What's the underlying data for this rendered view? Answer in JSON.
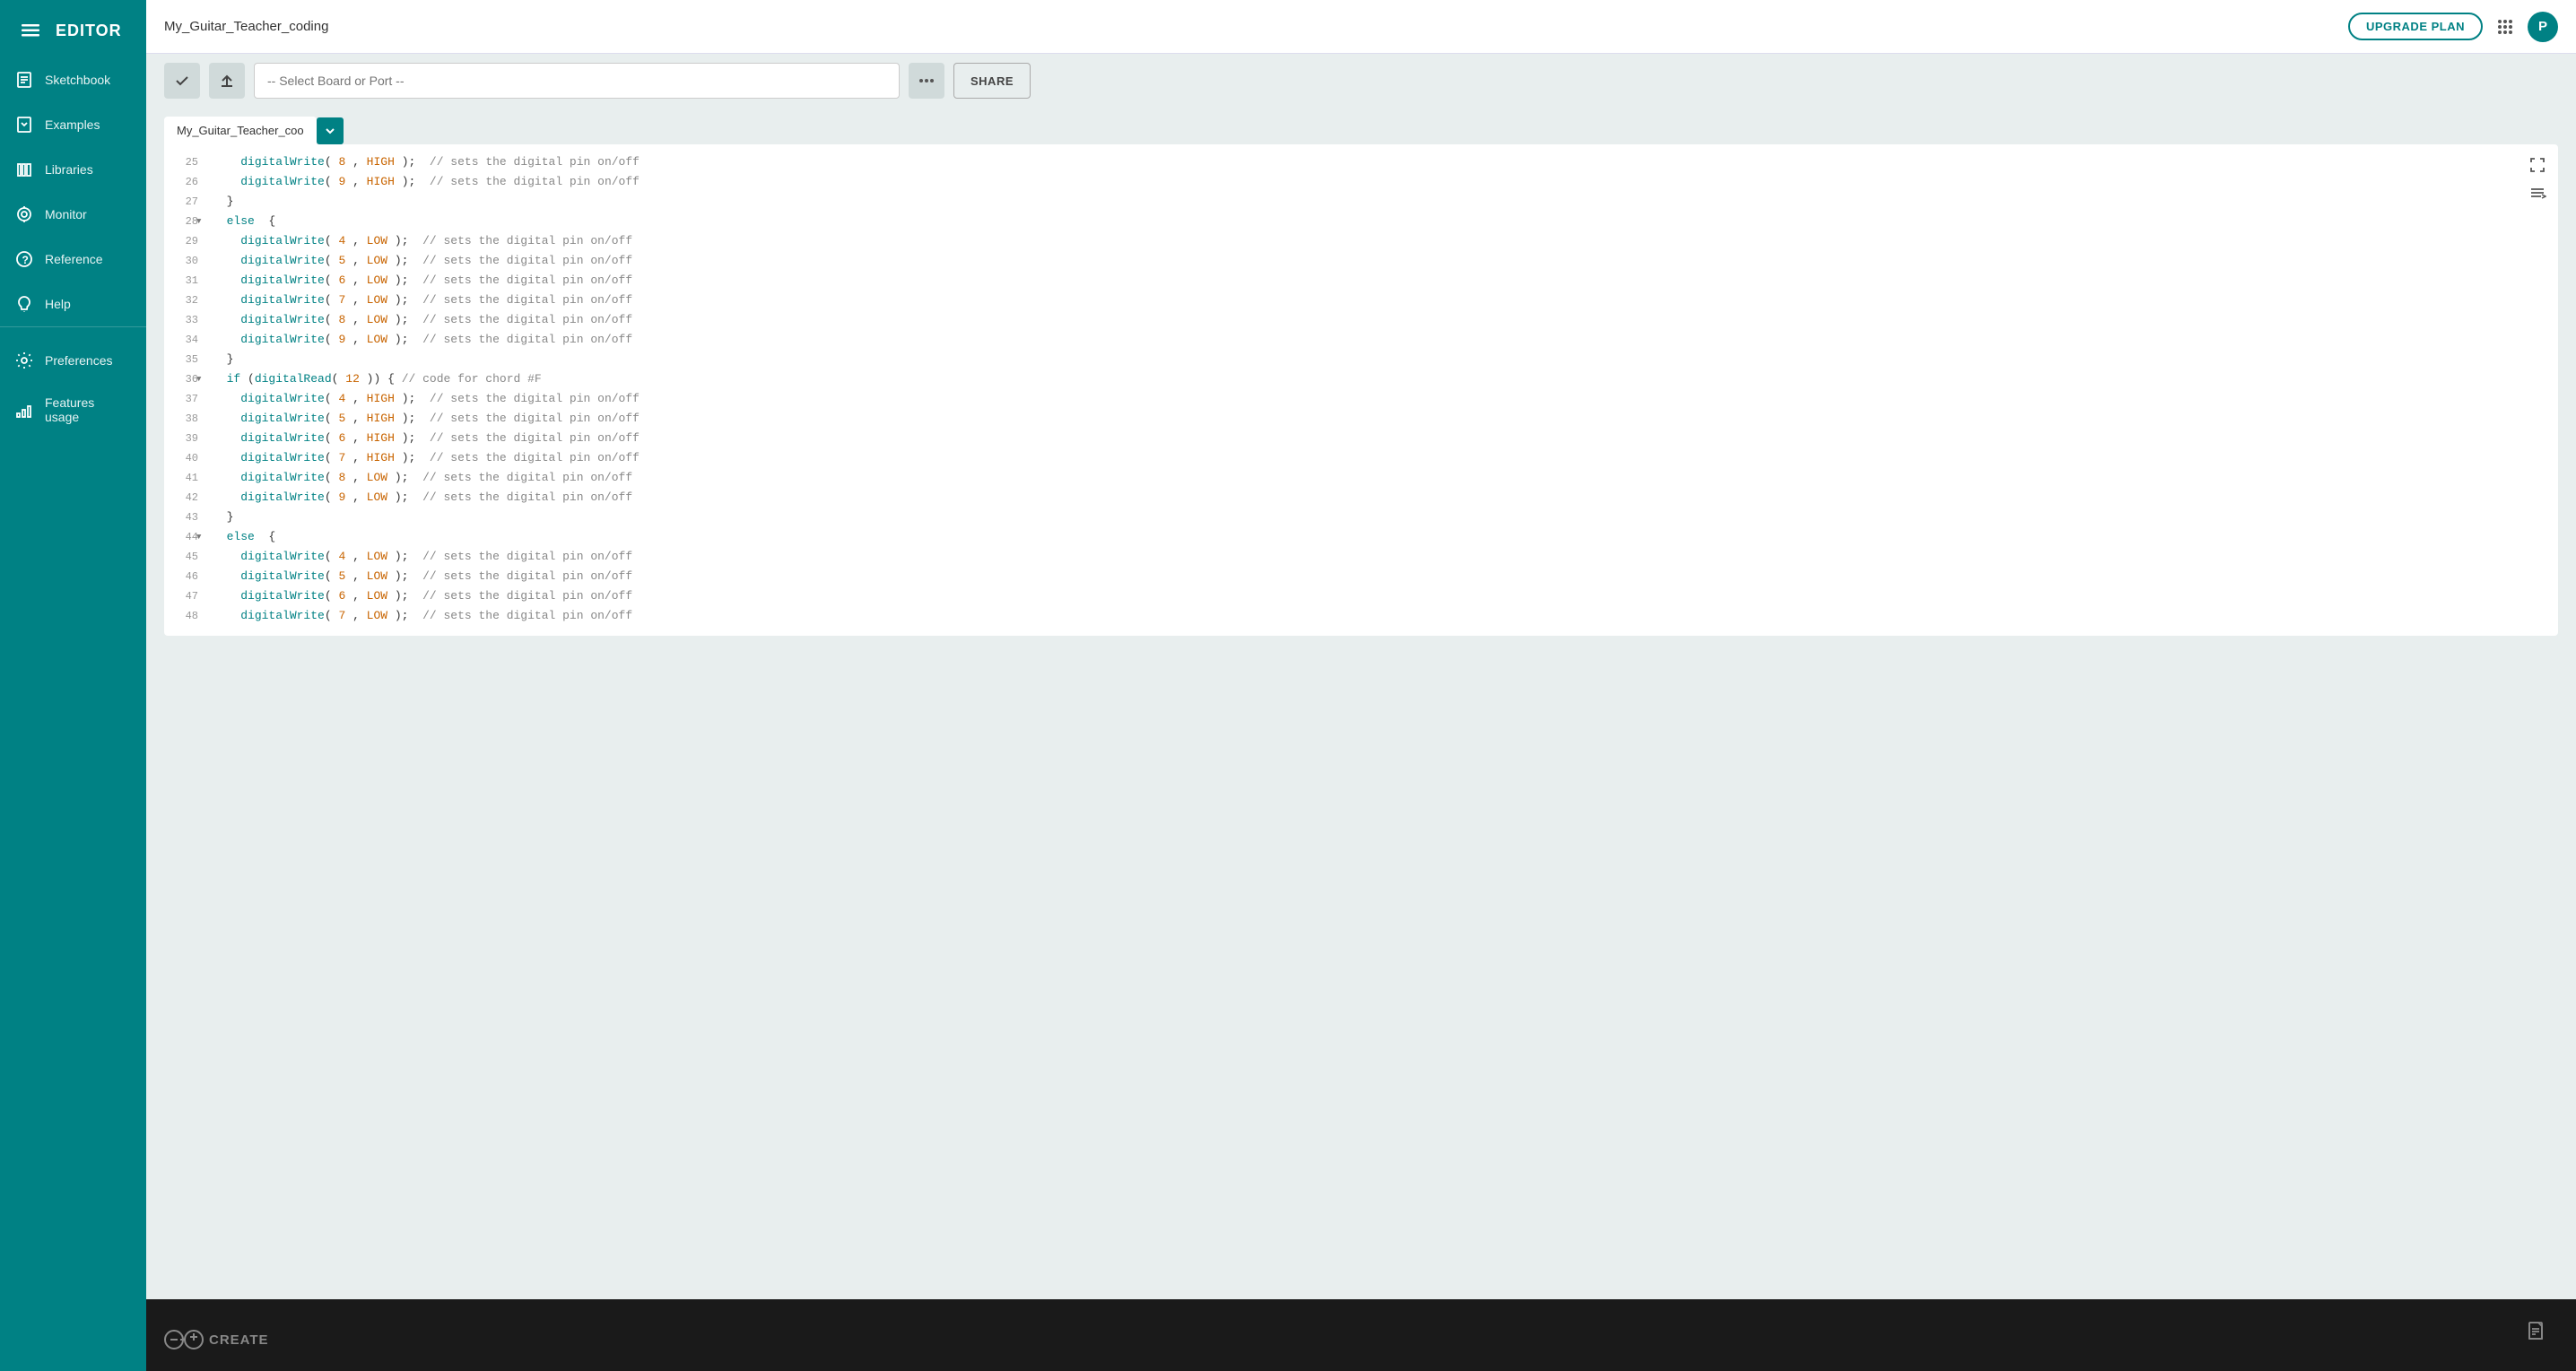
{
  "sidebar": {
    "logo_text": "EDITOR",
    "items": [
      {
        "id": "sketchbook",
        "label": "Sketchbook",
        "icon": "📁"
      },
      {
        "id": "examples",
        "label": "Examples",
        "icon": "📋"
      },
      {
        "id": "libraries",
        "label": "Libraries",
        "icon": "📚"
      },
      {
        "id": "monitor",
        "label": "Monitor",
        "icon": "🔍"
      },
      {
        "id": "reference",
        "label": "Reference",
        "icon": "❓"
      },
      {
        "id": "help",
        "label": "Help",
        "icon": "💬"
      },
      {
        "id": "preferences",
        "label": "Preferences",
        "icon": "⚙"
      },
      {
        "id": "features",
        "label": "Features usage",
        "icon": "📊"
      }
    ]
  },
  "topbar": {
    "title": "My_Guitar_Teacher_coding",
    "upgrade_label": "UPGRADE PLAN",
    "avatar_letter": "P"
  },
  "toolbar": {
    "verify_title": "Verify",
    "upload_title": "Upload",
    "board_placeholder": "-- Select Board or Port --",
    "more_title": "More options",
    "share_label": "SHARE"
  },
  "tab": {
    "label": "My_Guitar_Teacher_coo",
    "dropdown_title": "Tab dropdown"
  },
  "code": {
    "lines": [
      {
        "num": "25",
        "fold": false,
        "content": "    digitalWrite( 8 , HIGH );  // sets the digital pin on/off",
        "tokens": [
          {
            "text": "    ",
            "cls": ""
          },
          {
            "text": "digitalWrite",
            "cls": "kw-teal"
          },
          {
            "text": "( ",
            "cls": ""
          },
          {
            "text": "8",
            "cls": "kw-orange"
          },
          {
            "text": " , ",
            "cls": ""
          },
          {
            "text": "HIGH",
            "cls": "kw-orange"
          },
          {
            "text": " );  ",
            "cls": ""
          },
          {
            "text": "// sets the digital pin on/off",
            "cls": "kw-comment"
          }
        ]
      },
      {
        "num": "26",
        "fold": false,
        "content": "    digitalWrite( 9 , HIGH );  // sets the digital pin on/off",
        "tokens": [
          {
            "text": "    ",
            "cls": ""
          },
          {
            "text": "digitalWrite",
            "cls": "kw-teal"
          },
          {
            "text": "( ",
            "cls": ""
          },
          {
            "text": "9",
            "cls": "kw-orange"
          },
          {
            "text": " , ",
            "cls": ""
          },
          {
            "text": "HIGH",
            "cls": "kw-orange"
          },
          {
            "text": " );  ",
            "cls": ""
          },
          {
            "text": "// sets the digital pin on/off",
            "cls": "kw-comment"
          }
        ]
      },
      {
        "num": "27",
        "fold": false,
        "content": "  }",
        "tokens": [
          {
            "text": "  }",
            "cls": ""
          }
        ]
      },
      {
        "num": "28",
        "fold": true,
        "content": "  else  {",
        "tokens": [
          {
            "text": "  ",
            "cls": ""
          },
          {
            "text": "else",
            "cls": "kw-teal"
          },
          {
            "text": "  {",
            "cls": ""
          }
        ]
      },
      {
        "num": "29",
        "fold": false,
        "content": "    digitalWrite( 4 , LOW );  // sets the digital pin on/off",
        "tokens": [
          {
            "text": "    ",
            "cls": ""
          },
          {
            "text": "digitalWrite",
            "cls": "kw-teal"
          },
          {
            "text": "( ",
            "cls": ""
          },
          {
            "text": "4",
            "cls": "kw-orange"
          },
          {
            "text": " , ",
            "cls": ""
          },
          {
            "text": "LOW",
            "cls": "kw-orange"
          },
          {
            "text": " );  ",
            "cls": ""
          },
          {
            "text": "// sets the digital pin on/off",
            "cls": "kw-comment"
          }
        ]
      },
      {
        "num": "30",
        "fold": false,
        "content": "    digitalWrite( 5 , LOW );  // sets the digital pin on/off",
        "tokens": [
          {
            "text": "    ",
            "cls": ""
          },
          {
            "text": "digitalWrite",
            "cls": "kw-teal"
          },
          {
            "text": "( ",
            "cls": ""
          },
          {
            "text": "5",
            "cls": "kw-orange"
          },
          {
            "text": " , ",
            "cls": ""
          },
          {
            "text": "LOW",
            "cls": "kw-orange"
          },
          {
            "text": " );  ",
            "cls": ""
          },
          {
            "text": "// sets the digital pin on/off",
            "cls": "kw-comment"
          }
        ]
      },
      {
        "num": "31",
        "fold": false,
        "content": "    digitalWrite( 6 , LOW );  // sets the digital pin on/off",
        "tokens": [
          {
            "text": "    ",
            "cls": ""
          },
          {
            "text": "digitalWrite",
            "cls": "kw-teal"
          },
          {
            "text": "( ",
            "cls": ""
          },
          {
            "text": "6",
            "cls": "kw-orange"
          },
          {
            "text": " , ",
            "cls": ""
          },
          {
            "text": "LOW",
            "cls": "kw-orange"
          },
          {
            "text": " );  ",
            "cls": ""
          },
          {
            "text": "// sets the digital pin on/off",
            "cls": "kw-comment"
          }
        ]
      },
      {
        "num": "32",
        "fold": false,
        "content": "    digitalWrite( 7 , LOW );  // sets the digital pin on/off",
        "tokens": [
          {
            "text": "    ",
            "cls": ""
          },
          {
            "text": "digitalWrite",
            "cls": "kw-teal"
          },
          {
            "text": "( ",
            "cls": ""
          },
          {
            "text": "7",
            "cls": "kw-orange"
          },
          {
            "text": " , ",
            "cls": ""
          },
          {
            "text": "LOW",
            "cls": "kw-orange"
          },
          {
            "text": " );  ",
            "cls": ""
          },
          {
            "text": "// sets the digital pin on/off",
            "cls": "kw-comment"
          }
        ]
      },
      {
        "num": "33",
        "fold": false,
        "content": "    digitalWrite( 8 , LOW );  // sets the digital pin on/off",
        "tokens": [
          {
            "text": "    ",
            "cls": ""
          },
          {
            "text": "digitalWrite",
            "cls": "kw-teal"
          },
          {
            "text": "( ",
            "cls": ""
          },
          {
            "text": "8",
            "cls": "kw-orange"
          },
          {
            "text": " , ",
            "cls": ""
          },
          {
            "text": "LOW",
            "cls": "kw-orange"
          },
          {
            "text": " );  ",
            "cls": ""
          },
          {
            "text": "// sets the digital pin on/off",
            "cls": "kw-comment"
          }
        ]
      },
      {
        "num": "34",
        "fold": false,
        "content": "    digitalWrite( 9 , LOW );  // sets the digital pin on/off",
        "tokens": [
          {
            "text": "    ",
            "cls": ""
          },
          {
            "text": "digitalWrite",
            "cls": "kw-teal"
          },
          {
            "text": "( ",
            "cls": ""
          },
          {
            "text": "9",
            "cls": "kw-orange"
          },
          {
            "text": " , ",
            "cls": ""
          },
          {
            "text": "LOW",
            "cls": "kw-orange"
          },
          {
            "text": " );  ",
            "cls": ""
          },
          {
            "text": "// sets the digital pin on/off",
            "cls": "kw-comment"
          }
        ]
      },
      {
        "num": "35",
        "fold": false,
        "content": "  }",
        "tokens": [
          {
            "text": "  }",
            "cls": ""
          }
        ]
      },
      {
        "num": "36",
        "fold": true,
        "content": "  if (digitalRead( 12 )) { // code for chord #F",
        "tokens": [
          {
            "text": "  ",
            "cls": ""
          },
          {
            "text": "if",
            "cls": "kw-teal"
          },
          {
            "text": " (",
            "cls": ""
          },
          {
            "text": "digitalRead",
            "cls": "kw-teal"
          },
          {
            "text": "( ",
            "cls": ""
          },
          {
            "text": "12",
            "cls": "kw-orange"
          },
          {
            "text": " )) { ",
            "cls": ""
          },
          {
            "text": "// code for chord #F",
            "cls": "kw-comment"
          }
        ]
      },
      {
        "num": "37",
        "fold": false,
        "content": "    digitalWrite( 4 , HIGH );  // sets the digital pin on/off",
        "tokens": [
          {
            "text": "    ",
            "cls": ""
          },
          {
            "text": "digitalWrite",
            "cls": "kw-teal"
          },
          {
            "text": "( ",
            "cls": ""
          },
          {
            "text": "4",
            "cls": "kw-orange"
          },
          {
            "text": " , ",
            "cls": ""
          },
          {
            "text": "HIGH",
            "cls": "kw-orange"
          },
          {
            "text": " );  ",
            "cls": ""
          },
          {
            "text": "// sets the digital pin on/off",
            "cls": "kw-comment"
          }
        ]
      },
      {
        "num": "38",
        "fold": false,
        "content": "    digitalWrite( 5 , HIGH );  // sets the digital pin on/off",
        "tokens": [
          {
            "text": "    ",
            "cls": ""
          },
          {
            "text": "digitalWrite",
            "cls": "kw-teal"
          },
          {
            "text": "( ",
            "cls": ""
          },
          {
            "text": "5",
            "cls": "kw-orange"
          },
          {
            "text": " , ",
            "cls": ""
          },
          {
            "text": "HIGH",
            "cls": "kw-orange"
          },
          {
            "text": " );  ",
            "cls": ""
          },
          {
            "text": "// sets the digital pin on/off",
            "cls": "kw-comment"
          }
        ]
      },
      {
        "num": "39",
        "fold": false,
        "content": "    digitalWrite( 6 , HIGH );  // sets the digital pin on/off",
        "tokens": [
          {
            "text": "    ",
            "cls": ""
          },
          {
            "text": "digitalWrite",
            "cls": "kw-teal"
          },
          {
            "text": "( ",
            "cls": ""
          },
          {
            "text": "6",
            "cls": "kw-orange"
          },
          {
            "text": " , ",
            "cls": ""
          },
          {
            "text": "HIGH",
            "cls": "kw-orange"
          },
          {
            "text": " );  ",
            "cls": ""
          },
          {
            "text": "// sets the digital pin on/off",
            "cls": "kw-comment"
          }
        ]
      },
      {
        "num": "40",
        "fold": false,
        "content": "    digitalWrite( 7 , HIGH );  // sets the digital pin on/off",
        "tokens": [
          {
            "text": "    ",
            "cls": ""
          },
          {
            "text": "digitalWrite",
            "cls": "kw-teal"
          },
          {
            "text": "( ",
            "cls": ""
          },
          {
            "text": "7",
            "cls": "kw-orange"
          },
          {
            "text": " , ",
            "cls": ""
          },
          {
            "text": "HIGH",
            "cls": "kw-orange"
          },
          {
            "text": " );  ",
            "cls": ""
          },
          {
            "text": "// sets the digital pin on/off",
            "cls": "kw-comment"
          }
        ]
      },
      {
        "num": "41",
        "fold": false,
        "content": "    digitalWrite( 8 , LOW );  // sets the digital pin on/off",
        "tokens": [
          {
            "text": "    ",
            "cls": ""
          },
          {
            "text": "digitalWrite",
            "cls": "kw-teal"
          },
          {
            "text": "( ",
            "cls": ""
          },
          {
            "text": "8",
            "cls": "kw-orange"
          },
          {
            "text": " , ",
            "cls": ""
          },
          {
            "text": "LOW",
            "cls": "kw-orange"
          },
          {
            "text": " );  ",
            "cls": ""
          },
          {
            "text": "// sets the digital pin on/off",
            "cls": "kw-comment"
          }
        ]
      },
      {
        "num": "42",
        "fold": false,
        "content": "    digitalWrite( 9 , LOW );  // sets the digital pin on/off",
        "tokens": [
          {
            "text": "    ",
            "cls": ""
          },
          {
            "text": "digitalWrite",
            "cls": "kw-teal"
          },
          {
            "text": "( ",
            "cls": ""
          },
          {
            "text": "9",
            "cls": "kw-orange"
          },
          {
            "text": " , ",
            "cls": ""
          },
          {
            "text": "LOW",
            "cls": "kw-orange"
          },
          {
            "text": " );  ",
            "cls": ""
          },
          {
            "text": "// sets the digital pin on/off",
            "cls": "kw-comment"
          }
        ]
      },
      {
        "num": "43",
        "fold": false,
        "content": "  }",
        "tokens": [
          {
            "text": "  }",
            "cls": ""
          }
        ]
      },
      {
        "num": "44",
        "fold": true,
        "content": "  else  {",
        "tokens": [
          {
            "text": "  ",
            "cls": ""
          },
          {
            "text": "else",
            "cls": "kw-teal"
          },
          {
            "text": "  {",
            "cls": ""
          }
        ]
      },
      {
        "num": "45",
        "fold": false,
        "content": "    digitalWrite( 4 , LOW );  // sets the digital pin on/off",
        "tokens": [
          {
            "text": "    ",
            "cls": ""
          },
          {
            "text": "digitalWrite",
            "cls": "kw-teal"
          },
          {
            "text": "( ",
            "cls": ""
          },
          {
            "text": "4",
            "cls": "kw-orange"
          },
          {
            "text": " , ",
            "cls": ""
          },
          {
            "text": "LOW",
            "cls": "kw-orange"
          },
          {
            "text": " );  ",
            "cls": ""
          },
          {
            "text": "// sets the digital pin on/off",
            "cls": "kw-comment"
          }
        ]
      },
      {
        "num": "46",
        "fold": false,
        "content": "    digitalWrite( 5 , LOW );  // sets the digital pin on/off",
        "tokens": [
          {
            "text": "    ",
            "cls": ""
          },
          {
            "text": "digitalWrite",
            "cls": "kw-teal"
          },
          {
            "text": "( ",
            "cls": ""
          },
          {
            "text": "5",
            "cls": "kw-orange"
          },
          {
            "text": " , ",
            "cls": ""
          },
          {
            "text": "LOW",
            "cls": "kw-orange"
          },
          {
            "text": " );  ",
            "cls": ""
          },
          {
            "text": "// sets the digital pin on/off",
            "cls": "kw-comment"
          }
        ]
      },
      {
        "num": "47",
        "fold": false,
        "content": "    digitalWrite( 6 , LOW );  // sets the digital pin on/off",
        "tokens": [
          {
            "text": "    ",
            "cls": ""
          },
          {
            "text": "digitalWrite",
            "cls": "kw-teal"
          },
          {
            "text": "( ",
            "cls": ""
          },
          {
            "text": "6",
            "cls": "kw-orange"
          },
          {
            "text": " , ",
            "cls": ""
          },
          {
            "text": "LOW",
            "cls": "kw-orange"
          },
          {
            "text": " );  ",
            "cls": ""
          },
          {
            "text": "// sets the digital pin on/off",
            "cls": "kw-comment"
          }
        ]
      },
      {
        "num": "48",
        "fold": false,
        "content": "    digitalWrite( 7 , LOW );  // sets the digital pin on/off",
        "tokens": [
          {
            "text": "    ",
            "cls": ""
          },
          {
            "text": "digitalWrite",
            "cls": "kw-teal"
          },
          {
            "text": "( ",
            "cls": ""
          },
          {
            "text": "7",
            "cls": "kw-orange"
          },
          {
            "text": " , ",
            "cls": ""
          },
          {
            "text": "LOW",
            "cls": "kw-orange"
          },
          {
            "text": " );  ",
            "cls": ""
          },
          {
            "text": "// sets the digital pin on/off",
            "cls": "kw-comment"
          }
        ]
      }
    ]
  },
  "bottom": {
    "logo_text": "CREATE"
  }
}
